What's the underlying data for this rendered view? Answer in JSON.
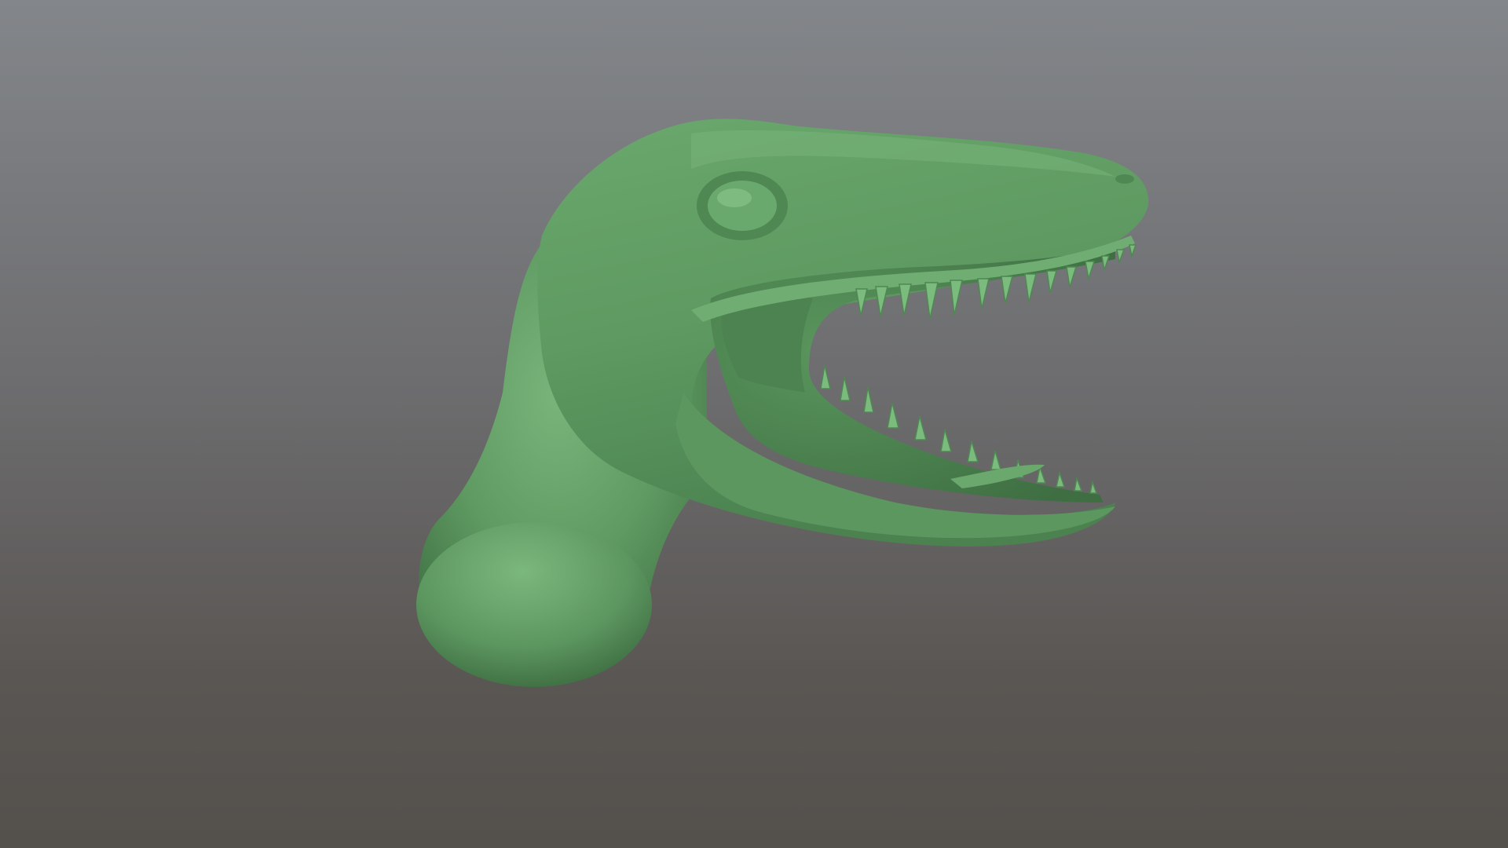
{
  "scene": {
    "subject": "sculpted-dinosaur-head",
    "colors": {
      "background_top": "#83868a",
      "background_bottom": "#54504c",
      "model_base": "#5f9a62",
      "model_light": "#79b57b",
      "model_shadow": "#3f7043",
      "mouth_interior": "#4f8752",
      "teeth": "#7cbb7e"
    }
  }
}
